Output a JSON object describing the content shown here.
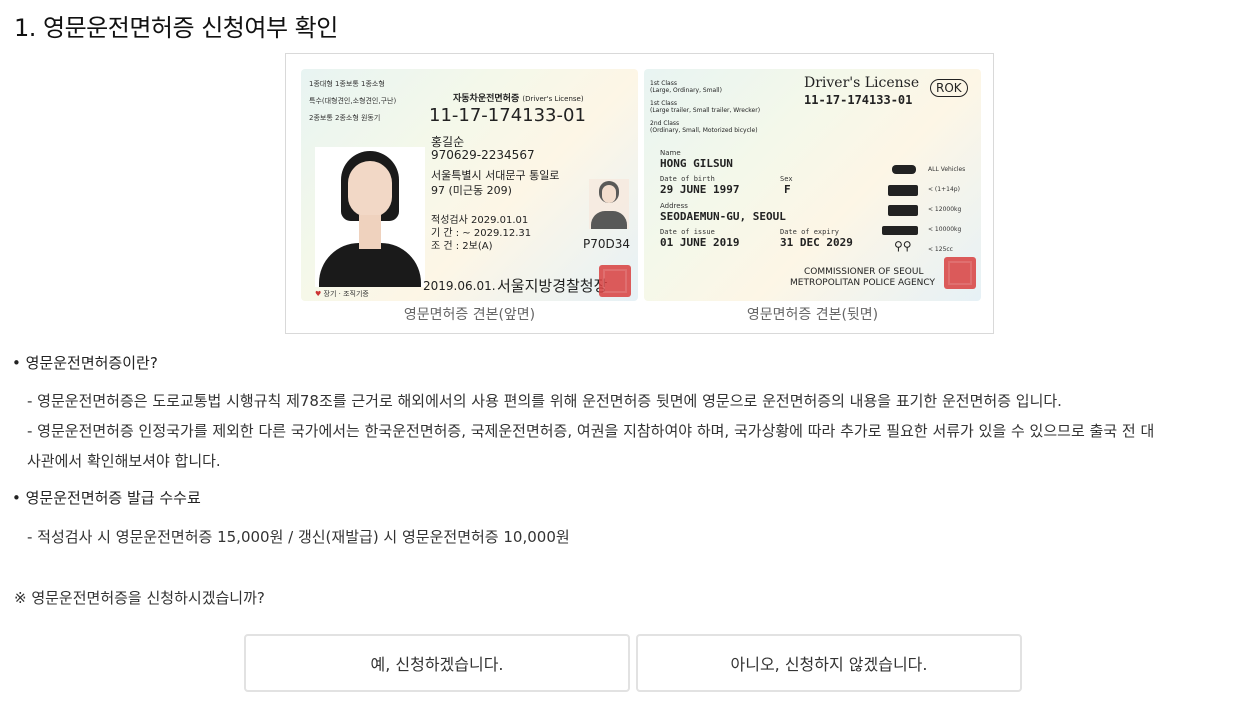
{
  "page": {
    "title": "1. 영문운전면허증 신청여부 확인"
  },
  "license_image": {
    "front": {
      "classes_line1": "1종대형 1종보통 1종소형",
      "classes_line2": "특수(대형견인,소형견인,구난)",
      "classes_line3": "2종보통 2종소형 원동기",
      "heading": "자동차운전면허증",
      "heading_en": "(Driver's License)",
      "license_no": "11-17-174133-01",
      "name": "홍길순",
      "rrn": "970629-2234567",
      "address1": "서울특별시 서대문구 통일로",
      "address2": "97 (미근동 209)",
      "aptitude": "적성검사  2029.01.01",
      "period": "기    간 : ~ 2029.12.31",
      "condition": "조    건 : 2보(A)",
      "serial": "P70D34",
      "issue": "2019.06.01.",
      "issuer": "서울지방경찰청장",
      "donor": "장기 · 조직기증"
    },
    "back": {
      "title": "Driver's License",
      "country": "ROK",
      "license_no": "11-17-174133-01",
      "class1": "1st Class",
      "class1_desc": "(Large, Ordinary, Small)",
      "class1b": "1st Class",
      "class1b_desc": "(Large trailer, Small trailer, Wrecker)",
      "class2": "2nd Class",
      "class2_desc": "(Ordinary, Small, Motorized bicycle)",
      "name_label": "Name",
      "name": "HONG GILSUN",
      "dob_label": "Date of birth",
      "dob": "29 JUNE 1997",
      "sex_label": "Sex",
      "sex": "F",
      "address_label": "Address",
      "address": "SEODAEMUN-GU, SEOUL",
      "issue_label": "Date of issue",
      "issue": "01 JUNE 2019",
      "expiry_label": "Date of expiry",
      "expiry": "31 DEC 2029",
      "authority1": "COMMISSIONER OF SEOUL",
      "authority2": "METROPOLITAN POLICE AGENCY",
      "vehicles": [
        "ALL Vehicles",
        "< (1+14p)",
        "< 12000kg",
        "< 10000kg",
        "< 125cc"
      ]
    },
    "caption_front": "영문면허증 견본(앞면)",
    "caption_back": "영문면허증 견본(뒷면)"
  },
  "section1": {
    "heading": "• 영문운전면허증이란?",
    "line1": "- 영문운전면허증은 도로교통법 시행규칙 제78조를 근거로 해외에서의 사용 편의를 위해 운전면허증 뒷면에 영문으로 운전면허증의 내용을 표기한 운전면허증 입니다.",
    "line2": "- 영문운전면허증 인정국가를 제외한 다른 국가에서는 한국운전면허증, 국제운전면허증, 여권을 지참하여야 하며, 국가상황에 따라 추가로 필요한 서류가 있을 수 있으므로 출국 전 대",
    "line3": "사관에서 확인해보셔야 합니다."
  },
  "section2": {
    "heading": "• 영문운전면허증 발급 수수료",
    "line1": "- 적성검사 시 영문운전면허증 15,000원 / 갱신(재발급) 시 영문운전면허증 10,000원"
  },
  "question": "※ 영문운전면허증을 신청하시겠습니까?",
  "buttons": {
    "yes": "예, 신청하겠습니다.",
    "no": "아니오, 신청하지 않겠습니다."
  }
}
